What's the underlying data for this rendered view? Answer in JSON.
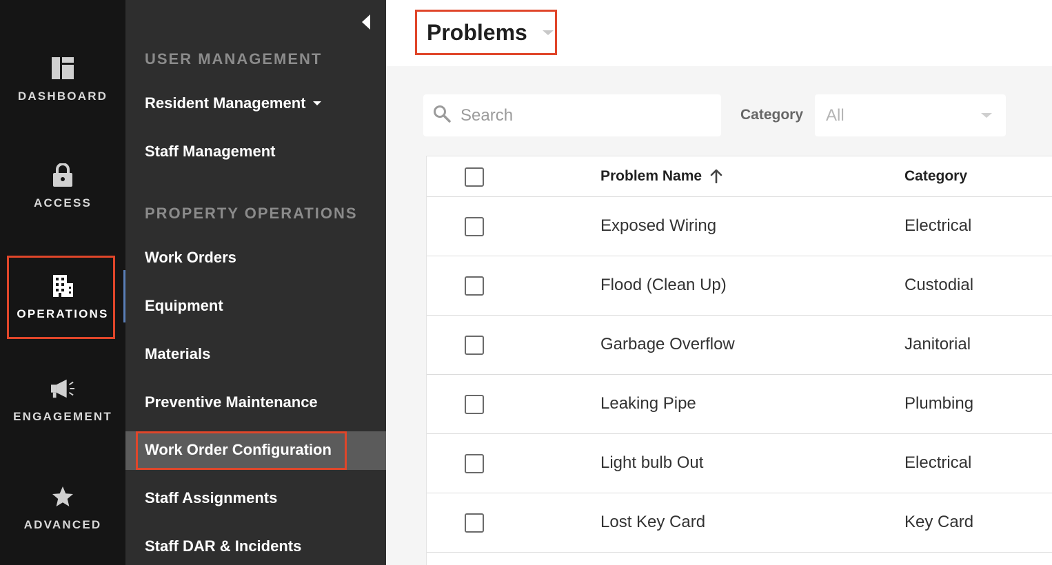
{
  "rail": {
    "items": [
      {
        "label": "DASHBOARD",
        "icon": "dashboard-icon"
      },
      {
        "label": "ACCESS",
        "icon": "lock-icon"
      },
      {
        "label": "OPERATIONS",
        "icon": "building-icon"
      },
      {
        "label": "ENGAGEMENT",
        "icon": "megaphone-icon"
      },
      {
        "label": "ADVANCED",
        "icon": "star-icon"
      }
    ],
    "active": "OPERATIONS"
  },
  "subnav": {
    "sections": [
      {
        "title": "USER MANAGEMENT"
      },
      {
        "title": "PROPERTY OPERATIONS"
      }
    ],
    "links": {
      "resident_management": "Resident Management",
      "staff_management": "Staff Management",
      "work_orders": "Work Orders",
      "equipment": "Equipment",
      "materials": "Materials",
      "preventive_maintenance": "Preventive Maintenance",
      "work_order_configuration": "Work Order Configuration",
      "staff_assignments": "Staff Assignments",
      "staff_dar_incidents": "Staff DAR & Incidents"
    },
    "selected": "Work Order Configuration"
  },
  "header": {
    "title": "Problems"
  },
  "filters": {
    "search_placeholder": "Search",
    "category_label": "Category",
    "category_value": "All"
  },
  "table": {
    "columns": [
      "Problem Name",
      "Category"
    ],
    "sort": {
      "column": "Problem Name",
      "direction": "asc"
    },
    "rows": [
      {
        "name": "Exposed Wiring",
        "category": "Electrical"
      },
      {
        "name": "Flood (Clean Up)",
        "category": "Custodial"
      },
      {
        "name": "Garbage Overflow",
        "category": "Janitorial"
      },
      {
        "name": "Leaking Pipe",
        "category": "Plumbing"
      },
      {
        "name": "Light bulb Out",
        "category": "Electrical"
      },
      {
        "name": "Lost Key Card",
        "category": "Key Card"
      }
    ]
  },
  "colors": {
    "highlight": "#e0462a",
    "rail_bg": "#151515",
    "subnav_bg": "#2e2e2e",
    "active_accent": "#5a7fb8"
  }
}
